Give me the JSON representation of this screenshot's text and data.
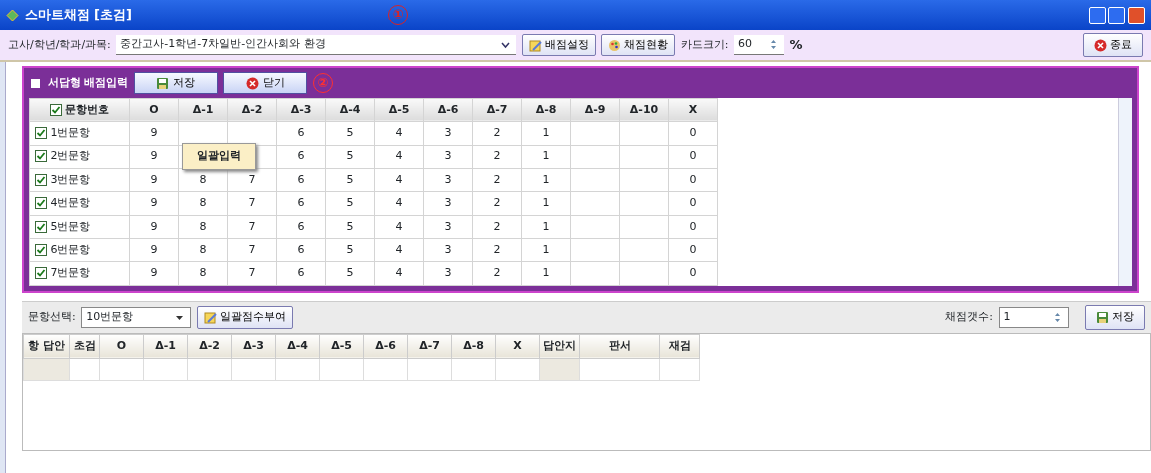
{
  "window": {
    "title": "스마트채점 [초검]",
    "annotation": "①"
  },
  "toolbar": {
    "label": "고사/학년/학과/과목:",
    "exam": "중간고사-1학년-7차일반-인간사회와 환경",
    "buttons": [
      "배점설정",
      "채점현황"
    ],
    "card_size_label": "카드크기:",
    "card_size": "60",
    "unit": "%",
    "exit": "종료"
  },
  "panel": {
    "title": "서답형 배점입력",
    "buttons": [
      "저장",
      "닫기"
    ],
    "annotation": "②",
    "columns": [
      "문항번호",
      "O",
      "Δ-1",
      "Δ-2",
      "Δ-3",
      "Δ-4",
      "Δ-5",
      "Δ-6",
      "Δ-7",
      "Δ-8",
      "Δ-9",
      "Δ-10",
      "X"
    ],
    "header_checked": true,
    "rows": [
      {
        "checked": true,
        "cells": [
          "1번문항",
          "9",
          null,
          null,
          "6",
          "5",
          "4",
          "3",
          "2",
          "1",
          null,
          null,
          "0"
        ]
      },
      {
        "checked": true,
        "cells": [
          "2번문항",
          "9",
          null,
          null,
          "6",
          "5",
          "4",
          "3",
          "2",
          "1",
          null,
          null,
          "0"
        ]
      },
      {
        "checked": true,
        "cells": [
          "3번문항",
          "9",
          "8",
          "7",
          "6",
          "5",
          "4",
          "3",
          "2",
          "1",
          null,
          null,
          "0"
        ]
      },
      {
        "checked": true,
        "cells": [
          "4번문항",
          "9",
          "8",
          "7",
          "6",
          "5",
          "4",
          "3",
          "2",
          "1",
          null,
          null,
          "0"
        ]
      },
      {
        "checked": true,
        "cells": [
          "5번문항",
          "9",
          "8",
          "7",
          "6",
          "5",
          "4",
          "3",
          "2",
          "1",
          null,
          null,
          "0"
        ]
      },
      {
        "checked": true,
        "cells": [
          "6번문항",
          "9",
          "8",
          "7",
          "6",
          "5",
          "4",
          "3",
          "2",
          "1",
          null,
          null,
          "0"
        ]
      },
      {
        "checked": true,
        "cells": [
          "7번문항",
          "9",
          "8",
          "7",
          "6",
          "5",
          "4",
          "3",
          "2",
          "1",
          null,
          null,
          "0"
        ]
      }
    ],
    "popup": "일괄입력"
  },
  "bottom": {
    "select_label": "문항선택:",
    "select_value": "10번문항",
    "bulk_button": "일괄점수부여",
    "count_label": "채점갯수:",
    "count": "1",
    "save": "저장",
    "columns": [
      "항 답안",
      "초검",
      "O",
      "Δ-1",
      "Δ-2",
      "Δ-3",
      "Δ-4",
      "Δ-5",
      "Δ-6",
      "Δ-7",
      "Δ-8",
      "X",
      "답안지",
      "판서",
      "재검"
    ]
  }
}
